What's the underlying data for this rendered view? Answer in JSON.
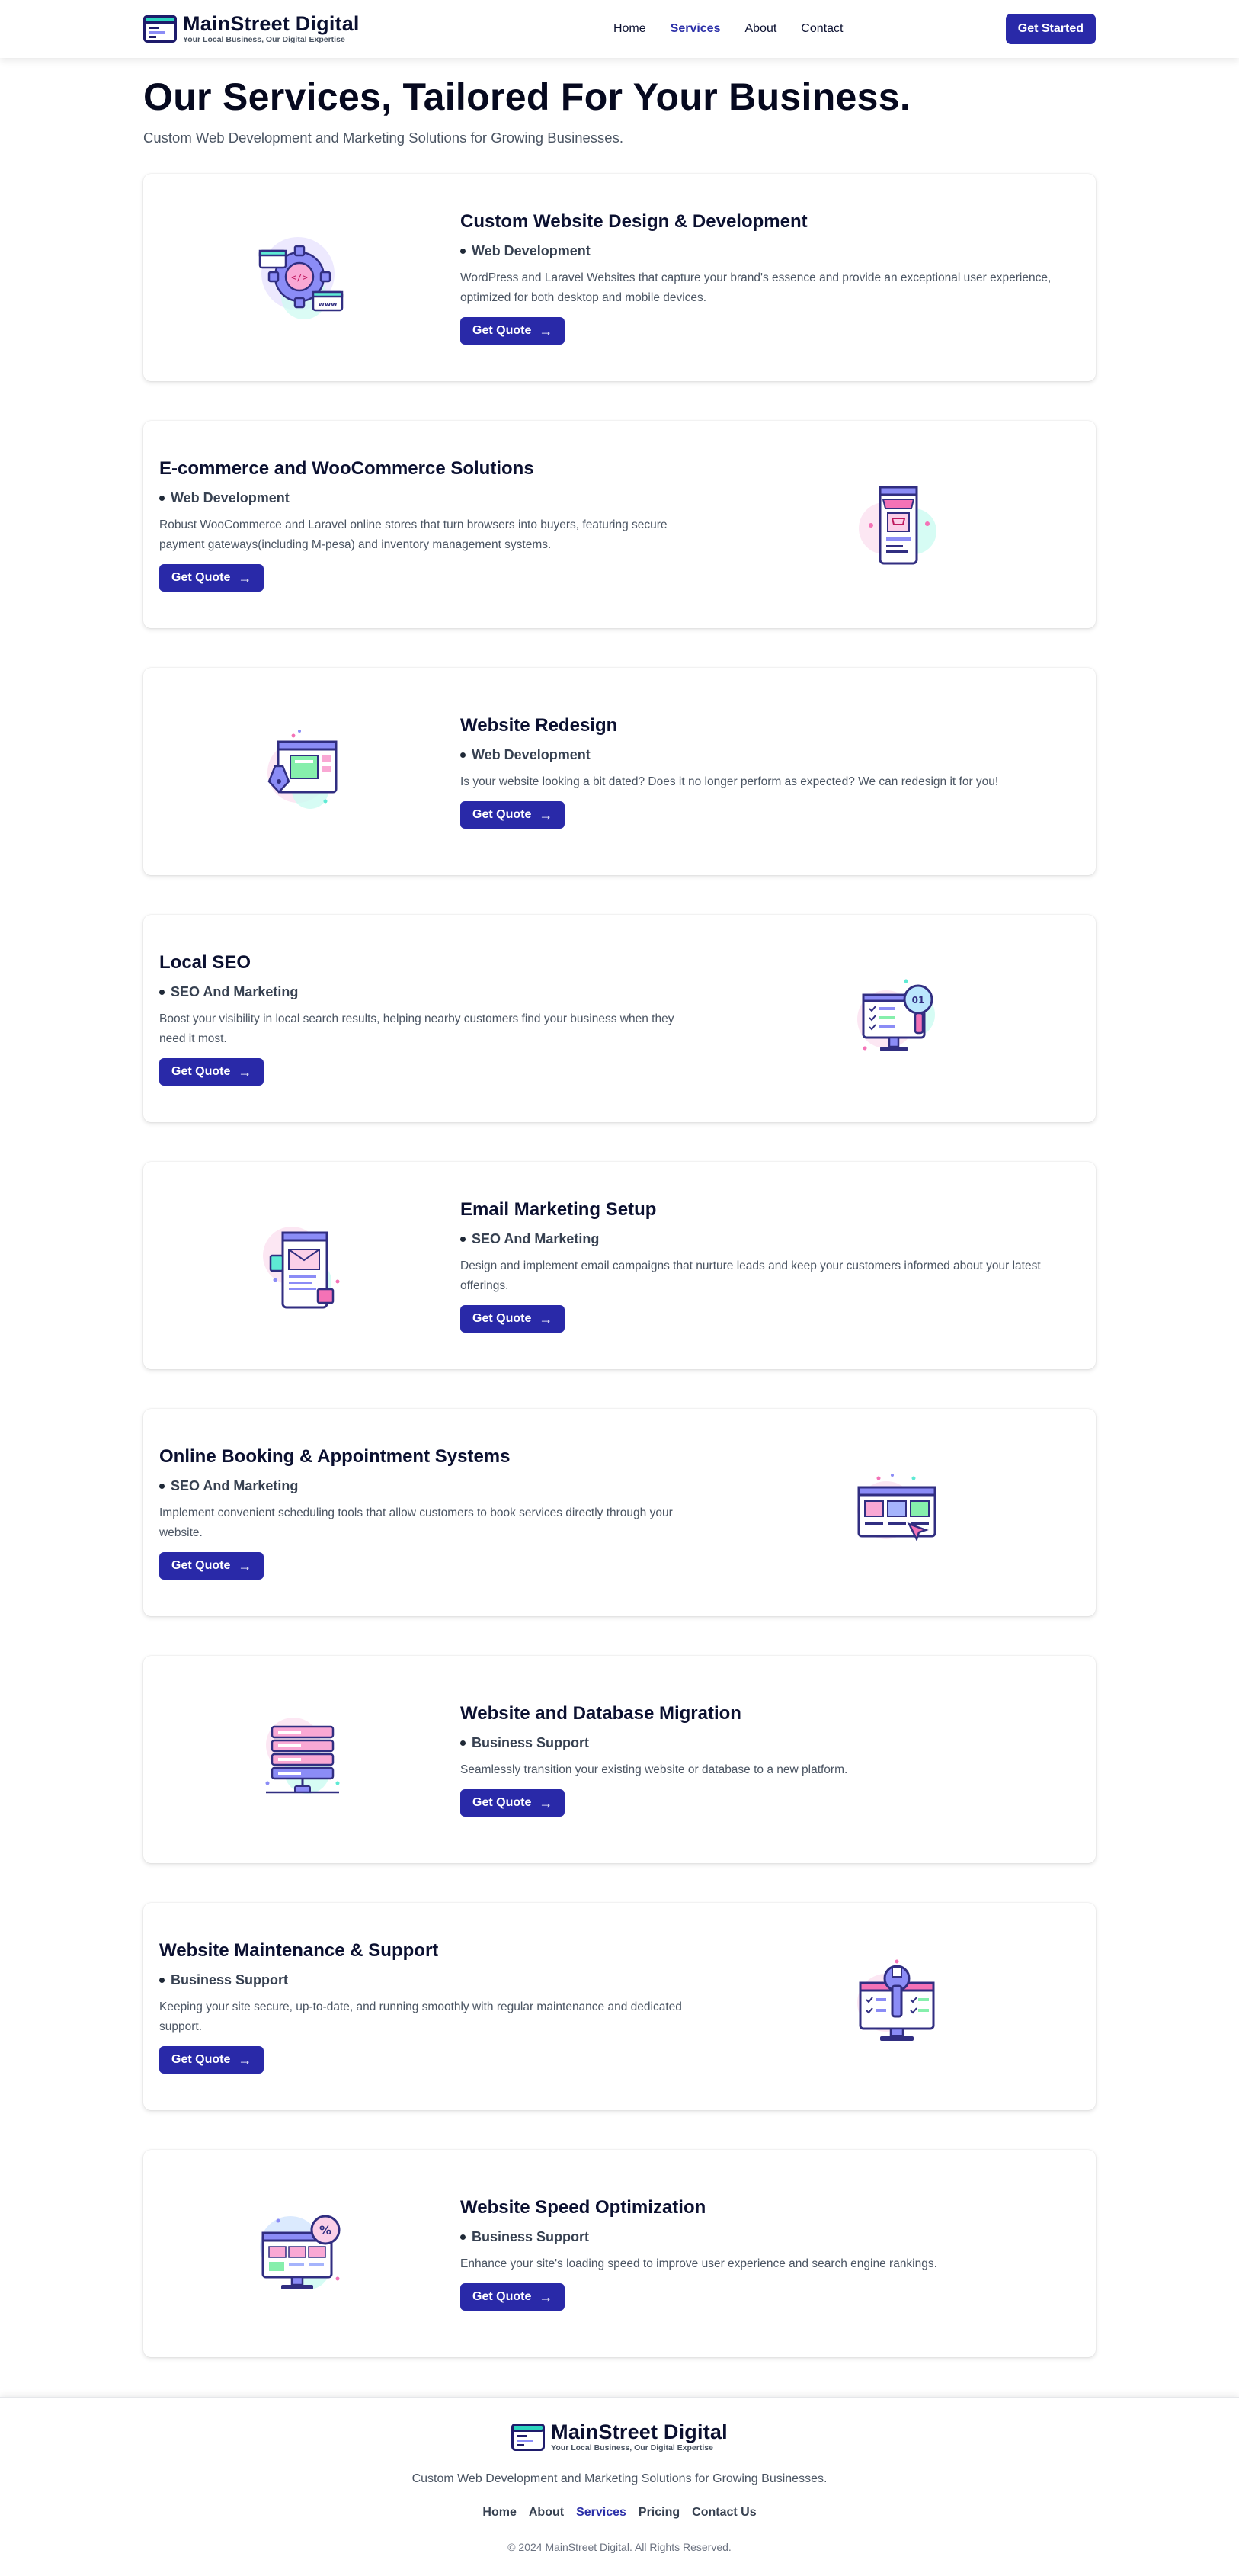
{
  "header": {
    "brand_name": "MainStreet Digital",
    "brand_tagline": "Your Local Business, Our Digital Expertise",
    "nav": [
      {
        "label": "Home",
        "active": false
      },
      {
        "label": "Services",
        "active": true
      },
      {
        "label": "About",
        "active": false
      },
      {
        "label": "Contact",
        "active": false
      }
    ],
    "cta_label": "Get Started"
  },
  "hero": {
    "title": "Our Services, Tailored For Your Business.",
    "subtitle": "Custom Web Development and Marketing Solutions for Growing Businesses."
  },
  "services": [
    {
      "title": "Custom Website Design & Development",
      "category": "Web Development",
      "description": "WordPress and Laravel Websites that capture your brand's essence and provide an exceptional user experience, optimized for both desktop and mobile devices.",
      "button": "Get Quote",
      "icon": "gear-code-icon"
    },
    {
      "title": "E-commerce and WooCommerce Solutions",
      "category": "Web Development",
      "description": "Robust WooCommerce and Laravel online stores that turn browsers into buyers, featuring secure payment gateways(including M-pesa) and inventory management systems.",
      "button": "Get Quote",
      "icon": "mobile-store-icon"
    },
    {
      "title": "Website Redesign",
      "category": "Web Development",
      "description": "Is your website looking a bit dated? Does it no longer perform as expected? We can redesign it for you!",
      "button": "Get Quote",
      "icon": "pen-browser-icon"
    },
    {
      "title": "Local SEO",
      "category": "SEO And Marketing",
      "description": "Boost your visibility in local search results, helping nearby customers find your business when they need it most.",
      "button": "Get Quote",
      "icon": "monitor-search-icon"
    },
    {
      "title": "Email Marketing Setup",
      "category": "SEO And Marketing",
      "description": "Design and implement email campaigns that nurture leads and keep your customers informed about your latest offerings.",
      "button": "Get Quote",
      "icon": "email-phone-icon"
    },
    {
      "title": "Online Booking & Appointment Systems",
      "category": "SEO And Marketing",
      "description": "Implement convenient scheduling tools that allow customers to book services directly through your website.",
      "button": "Get Quote",
      "icon": "calendar-browser-icon"
    },
    {
      "title": "Website and Database Migration",
      "category": "Business Support",
      "description": "Seamlessly transition your existing website or database to a new platform.",
      "button": "Get Quote",
      "icon": "database-server-icon"
    },
    {
      "title": "Website Maintenance & Support",
      "category": "Business Support",
      "description": "Keeping your site secure, up-to-date, and running smoothly with regular maintenance and dedicated support.",
      "button": "Get Quote",
      "icon": "wrench-monitor-icon"
    },
    {
      "title": "Website Speed Optimization",
      "category": "Business Support",
      "description": "Enhance your site's loading speed to improve user experience and search engine rankings.",
      "button": "Get Quote",
      "icon": "speed-monitor-icon"
    }
  ],
  "footer": {
    "brand_name": "MainStreet Digital",
    "brand_tagline": "Your Local Business, Our Digital Expertise",
    "tagline": "Custom Web Development and Marketing Solutions for Growing Businesses.",
    "nav": [
      {
        "label": "Home",
        "active": false
      },
      {
        "label": "About",
        "active": false
      },
      {
        "label": "Services",
        "active": true
      },
      {
        "label": "Pricing",
        "active": false
      },
      {
        "label": "Contact Us",
        "active": false
      }
    ],
    "copyright": "© 2024 MainStreet Digital. All Rights Reserved."
  },
  "colors": {
    "primary": "#2929a8",
    "heading": "#0b1030",
    "accent_pink": "#f472b6",
    "accent_teal": "#5eead4",
    "accent_purple": "#8b8cf6"
  }
}
